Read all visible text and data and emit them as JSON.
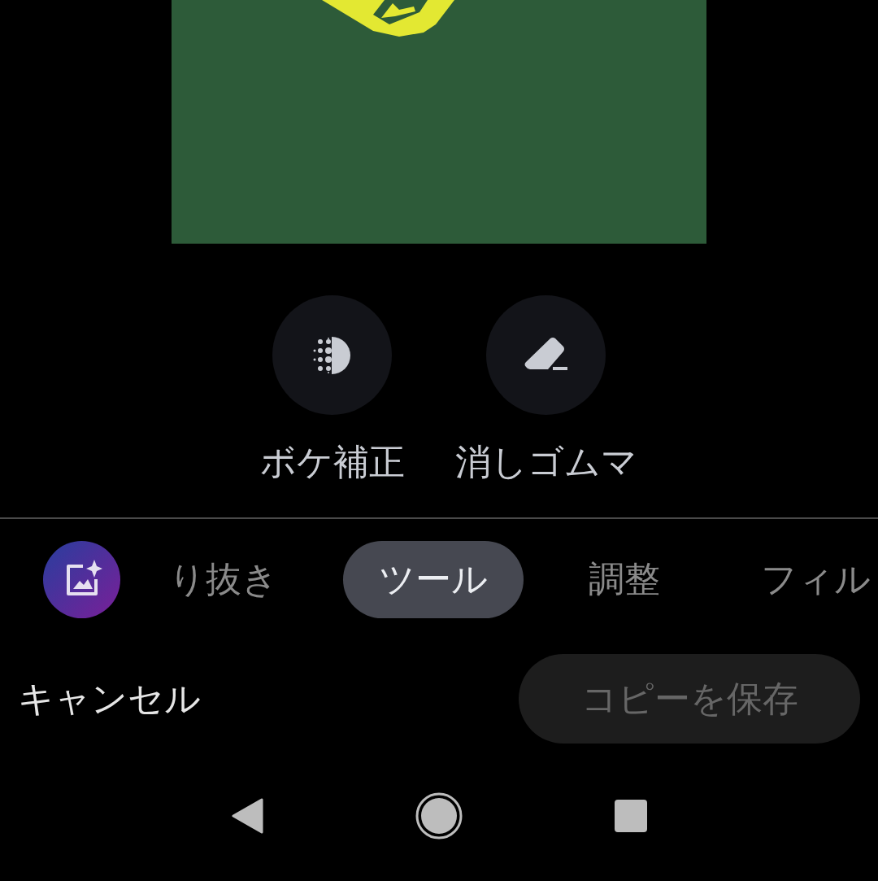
{
  "tools": [
    {
      "kind": "bokeh",
      "label": "ボケ補正"
    },
    {
      "kind": "eraser",
      "label": "消しゴムマ"
    }
  ],
  "tabs": [
    {
      "label": "り抜き",
      "selected": false
    },
    {
      "label": "ツール",
      "selected": true
    },
    {
      "label": "調整",
      "selected": false
    },
    {
      "label": "フィル",
      "selected": false
    }
  ],
  "actions": {
    "cancel": "キャンセル",
    "save": {
      "label": "コピーを保存",
      "disabled": true
    }
  }
}
